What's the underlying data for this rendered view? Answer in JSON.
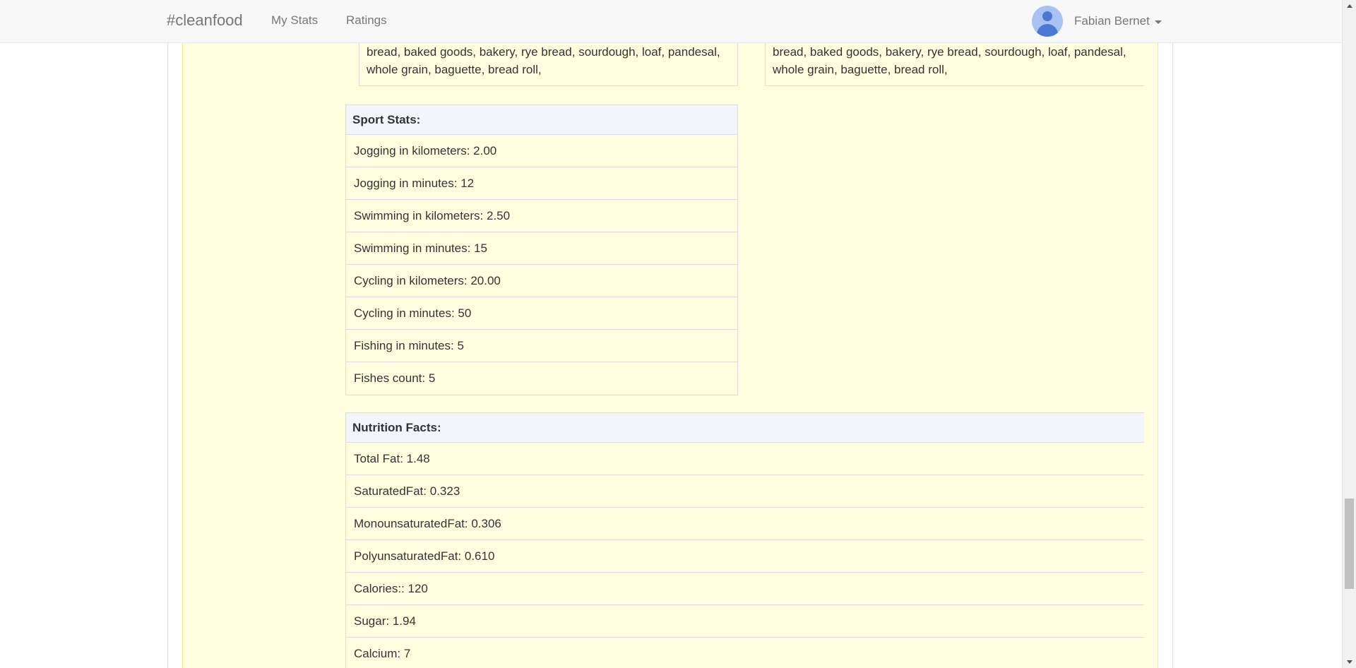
{
  "navbar": {
    "brand": "#cleanfood",
    "links": [
      "My Stats",
      "Ratings"
    ],
    "user_name": "Fabian Bernet"
  },
  "tags": {
    "left_text": "bread, baked goods, bakery, rye bread, sourdough, loaf, pandesal, whole grain, baguette, bread roll,",
    "right_text": "bread, baked goods, bakery, rye bread, sourdough, loaf, pandesal, whole grain, baguette, bread roll,"
  },
  "sport_stats": {
    "title": "Sport Stats:",
    "items": [
      "Jogging in kilometers: 2.00",
      "Jogging in minutes: 12",
      "Swimming in kilometers: 2.50",
      "Swimming in minutes: 15",
      "Cycling in kilometers: 20.00",
      "Cycling in minutes: 50",
      "Fishing in minutes: 5",
      "Fishes count: 5"
    ]
  },
  "nutrition_facts": {
    "title": "Nutrition Facts:",
    "items": [
      "Total Fat: 1.48",
      "SaturatedFat: 0.323",
      "MonounsaturatedFat: 0.306",
      "PolyunsaturatedFat: 0.610",
      "Calories:: 120",
      "Sugar: 1.94",
      "Calcium: 7"
    ]
  }
}
